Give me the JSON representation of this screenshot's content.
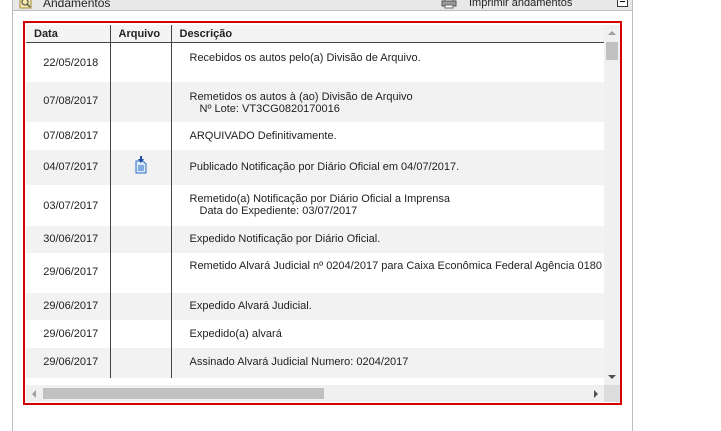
{
  "header": {
    "title": "Andamentos",
    "print_label": "Imprimir andamentos"
  },
  "table": {
    "columns": [
      "Data",
      "Arquivo",
      "Descrição"
    ],
    "rows": [
      {
        "date": "22/05/2018",
        "file_icon": "",
        "desc": "Recebidos os autos pelo(a) Divisão de Arquivo.",
        "sub": ""
      },
      {
        "date": "07/08/2017",
        "file_icon": "",
        "desc": "Remetidos os autos à (ao) Divisão de Arquivo",
        "sub": "Nº Lote: VT3CG0820170016"
      },
      {
        "date": "07/08/2017",
        "file_icon": "",
        "desc": "ARQUIVADO Definitivamente.",
        "sub": ""
      },
      {
        "date": "04/07/2017",
        "file_icon": "document-download-icon",
        "desc": "Publicado Notificação por Diário Oficial em 04/07/2017.",
        "sub": ""
      },
      {
        "date": "03/07/2017",
        "file_icon": "",
        "desc": "Remetido(a) Notificação por Diário Oficial a Imprensa",
        "sub": "Data do Expediente: 03/07/2017"
      },
      {
        "date": "30/06/2017",
        "file_icon": "",
        "desc": "Expedido Notificação por Diário Oficial.",
        "sub": ""
      },
      {
        "date": "29/06/2017",
        "file_icon": "",
        "desc": "Remetido Alvará Judicial nº 0204/2017 para Caixa Econômica Federal Agência 0180",
        "sub": ""
      },
      {
        "date": "29/06/2017",
        "file_icon": "",
        "desc": "Expedido Alvará Judicial.",
        "sub": ""
      },
      {
        "date": "29/06/2017",
        "file_icon": "",
        "desc": "Expedido(a) alvará",
        "sub": ""
      },
      {
        "date": "29/06/2017",
        "file_icon": "",
        "desc": "Assinado Alvará Judicial Numero: 0204/2017",
        "sub": ""
      }
    ]
  },
  "colors": {
    "highlight_border": "#d40000",
    "alt_row": "#f2f2f2",
    "icon_blue": "#2a6fc9"
  }
}
